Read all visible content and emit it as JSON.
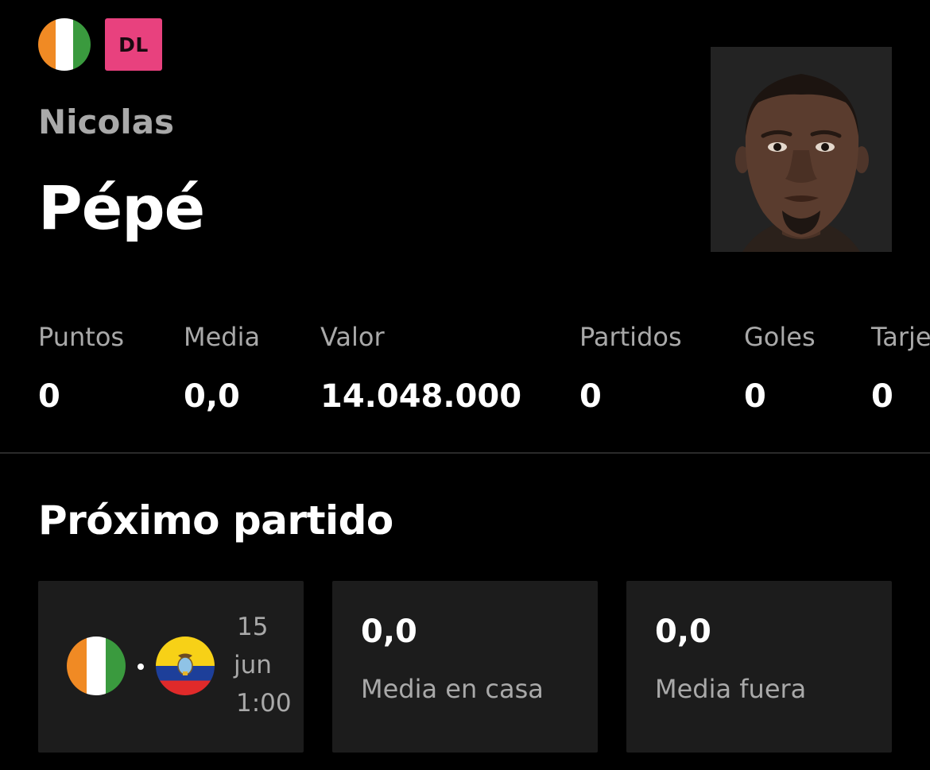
{
  "player": {
    "nationality_flag": "ivory-coast-flag",
    "position": "DL",
    "first_name": "Nicolas",
    "last_name": "Pépé"
  },
  "stats": [
    {
      "label": "Puntos",
      "value": "0"
    },
    {
      "label": "Media",
      "value": "0,0"
    },
    {
      "label": "Valor",
      "value": "14.048.000"
    },
    {
      "label": "Partidos",
      "value": "0"
    },
    {
      "label": "Goles",
      "value": "0"
    },
    {
      "label": "Tarjetas",
      "value": "0"
    }
  ],
  "next_match": {
    "title": "Próximo partido",
    "home_flag": "ivory-coast-flag",
    "away_flag": "ecuador-flag",
    "date_day": "15",
    "date_month": "jun",
    "date_time": "1:00",
    "home_avg_value": "0,0",
    "home_avg_label": "Media en casa",
    "away_avg_value": "0,0",
    "away_avg_label": "Media fuera"
  },
  "colors": {
    "background": "#000000",
    "badge": "#e8417e",
    "card": "#1c1c1c",
    "muted_text": "#a9a9a9",
    "divider": "#2a2a2a"
  }
}
